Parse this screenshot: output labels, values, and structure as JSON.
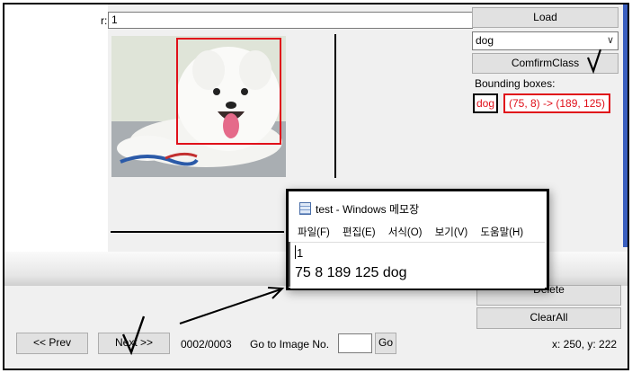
{
  "window": {
    "dir_label": "r:",
    "dir_value": "1"
  },
  "toolbar": {
    "load_label": "Load",
    "class_selected": "dog",
    "confirm_label": "ComfirmClass",
    "bbox_title": "Bounding boxes:"
  },
  "bboxes": [
    {
      "class": "dog",
      "coords": "(75, 8) -> (189, 125)"
    }
  ],
  "actions": {
    "delete_label": "Delete",
    "clearall_label": "ClearAll"
  },
  "nav": {
    "prev_label": "<< Prev",
    "next_label": "Next >>",
    "counter": "0002/0003",
    "goto_label": "Go to Image No.",
    "goto_value": "",
    "go_label": "Go",
    "cursor": "x: 250, y: 222"
  },
  "notepad": {
    "title": "test - Windows 메모장",
    "menu": [
      "파일(F)",
      "편집(E)",
      "서식(O)",
      "보기(V)",
      "도움말(H)"
    ],
    "line1": "1",
    "line2": "75 8 189 125 dog"
  },
  "colors": {
    "bbox": "#e0101a",
    "accent_scroll": "#3a5fbf"
  },
  "icons": [
    "checkmark-annotation",
    "arrow-annotation",
    "notepad-icon",
    "chevron-down-icon"
  ]
}
